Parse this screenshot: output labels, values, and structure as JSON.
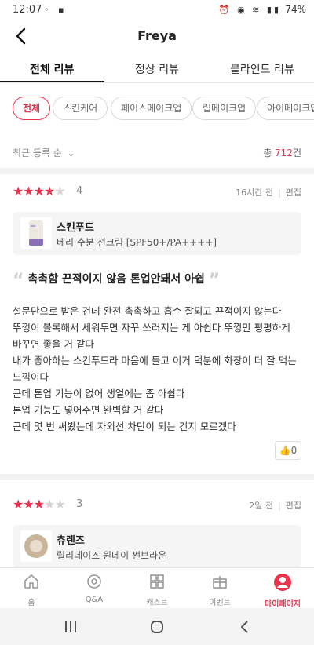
{
  "status_bar": {
    "time": "12:07",
    "battery": "74%"
  },
  "header": {
    "title": "Freya"
  },
  "tabs": [
    {
      "label": "전체 리뷰"
    },
    {
      "label": "정상 리뷰"
    },
    {
      "label": "블라인드 리뷰"
    }
  ],
  "chips": [
    {
      "label": "전체"
    },
    {
      "label": "스킨케어"
    },
    {
      "label": "페이스메이크업"
    },
    {
      "label": "립메이크업"
    },
    {
      "label": "아이메이크업"
    }
  ],
  "sort": {
    "label": "최근 등록 순"
  },
  "total": {
    "prefix": "총 ",
    "count": "712",
    "suffix": "건"
  },
  "reviews": [
    {
      "rating": 4,
      "rating_text": "4",
      "time": "16시간 전",
      "edit": "편집",
      "brand": "스킨푸드",
      "product": "베리 수분 선크림 [SPF50+/PA++++]",
      "headline": "촉촉함 끈적이지 않음 톤업안돼서 아쉽",
      "body": [
        "설문단으로 받은 건데 완전 촉촉하고 흡수 잘되고 끈적이지 않는다",
        "뚜껑이 볼록해서 세워두면 자꾸 쓰러지는 게 아쉽다 뚜껑만 평평하게",
        "바꾸면 좋을 거 같다",
        "내가 좋아하는 스킨푸드라 마음에 들고 이거 덕분에 화장이 더 잘 먹는",
        "느낌이다",
        "근데 톤업 기능이 없어 생얼에는 좀 아쉽다",
        "톤업 기능도 넣어주면 완벽할 거 같다",
        "근데 몇 번 써봤는데 자외선 차단이 되는 건지 모르겠다"
      ],
      "likes": "0"
    },
    {
      "rating": 3,
      "rating_text": "3",
      "time": "2일 전",
      "edit": "편집",
      "brand": "츄렌즈",
      "product": "릴리데이즈 원데이 썬브라운"
    }
  ],
  "bottom_nav": [
    {
      "label": "홈",
      "icon": "home-icon"
    },
    {
      "label": "Q&A",
      "icon": "qa-icon"
    },
    {
      "label": "캐스트",
      "icon": "grid-icon"
    },
    {
      "label": "이벤트",
      "icon": "gift-icon"
    },
    {
      "label": "마이페이지",
      "icon": "user-icon"
    }
  ],
  "colors": {
    "accent": "#e8344e",
    "star_off": "#d4d4d4",
    "product_bg": "#f5f5f5"
  }
}
